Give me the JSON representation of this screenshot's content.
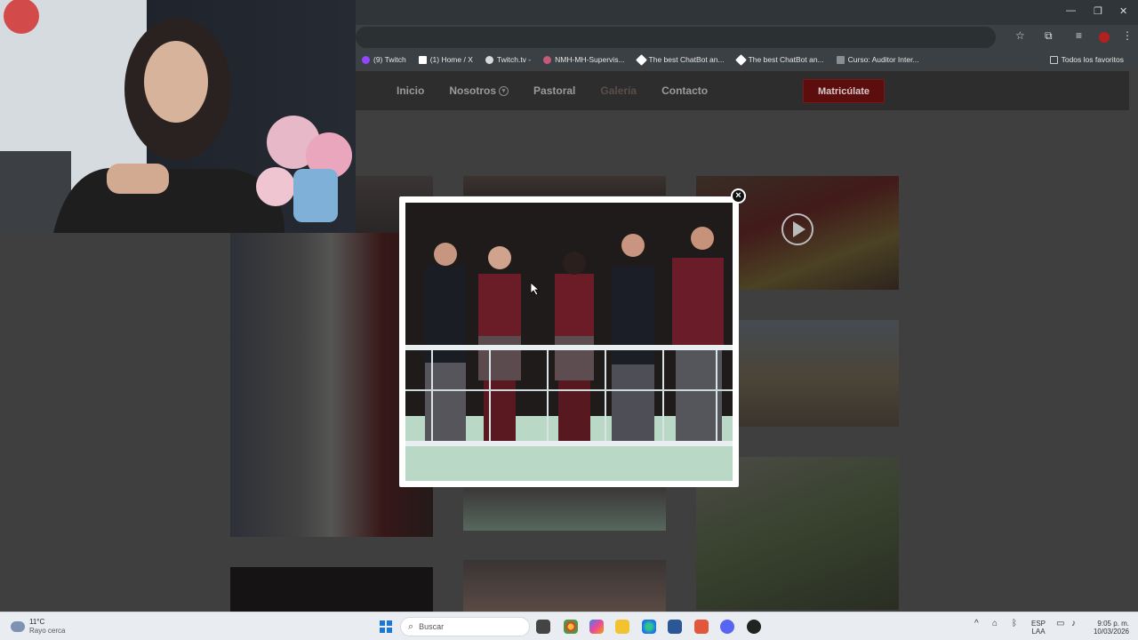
{
  "browser": {
    "bookmarks": [
      {
        "label": "(9) Twitch",
        "icon": "twitch-icon"
      },
      {
        "label": "(1) Home / X",
        "icon": "x-icon"
      },
      {
        "label": "Twitch.tv -",
        "icon": "twitch-tv-icon"
      },
      {
        "label": "NMH-MH-Supervis...",
        "icon": "nmh-icon"
      },
      {
        "label": "The best ChatBot an...",
        "icon": "chatbot-icon"
      },
      {
        "label": "The best ChatBot an...",
        "icon": "chatbot-icon"
      },
      {
        "label": "Curso: Auditor Inter...",
        "icon": "course-icon"
      }
    ],
    "all_bookmarks_label": "Todos los favoritos"
  },
  "site": {
    "nav": {
      "items": [
        "Inicio",
        "Nosotros",
        "Pastoral",
        "Galería",
        "Contacto"
      ],
      "active": "Galería",
      "cta": "Matricúlate"
    }
  },
  "lightbox": {
    "close_symbol": "×",
    "image": "Five students in maroon and black school uniforms standing behind a white railing"
  },
  "taskbar": {
    "weather_temp": "11°C",
    "weather_text": "Rayo cerca",
    "search_placeholder": "Buscar",
    "lang_top": "ESP",
    "lang_bottom": "LAA",
    "time": "9:05 p. m.",
    "date": "10/03/2026"
  },
  "colors": {
    "cta_bg": "#5c0d0d",
    "overlay": "#3f3f3f",
    "taskbar": "#e9edf2"
  }
}
